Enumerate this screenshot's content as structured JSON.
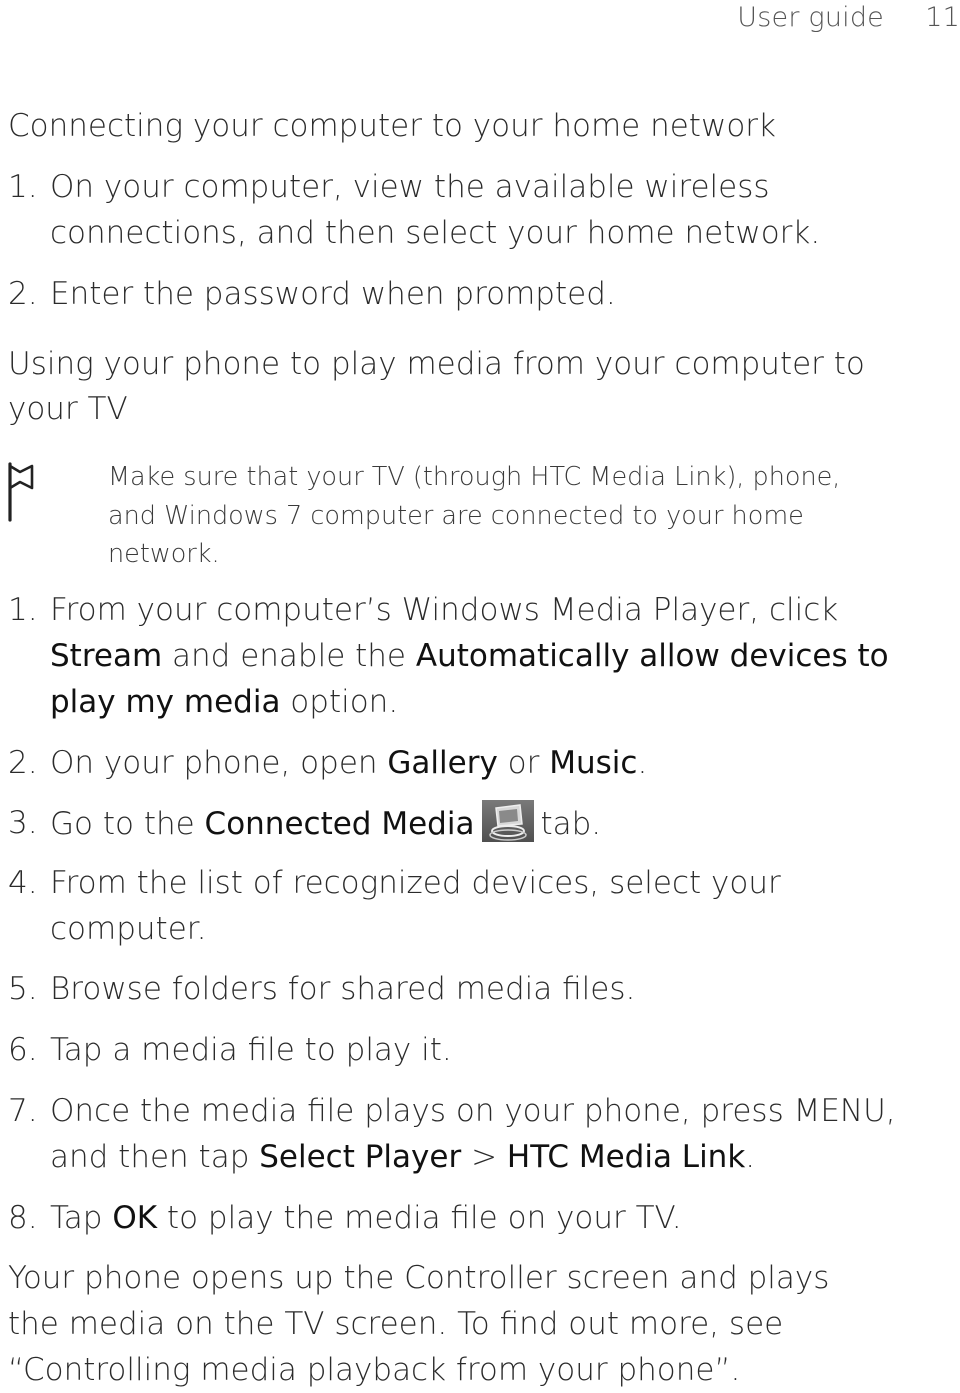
{
  "header": {
    "title": "User guide",
    "page_number": "11"
  },
  "section1": {
    "heading": "Connecting your computer to your home network",
    "steps": [
      {
        "n": "1.",
        "lines": [
          "On your computer, view the available wireless",
          "connections, and then select your home network."
        ]
      },
      {
        "n": "2.",
        "lines": [
          "Enter the password when prompted."
        ]
      }
    ]
  },
  "section2": {
    "heading_lines": [
      "Using your phone to play media from your computer to",
      "your TV"
    ],
    "note": {
      "icon": "flag-icon",
      "lines": [
        "Make sure that your TV (through HTC Media Link), phone,",
        "and Windows 7 computer are connected to your home",
        "network."
      ]
    },
    "steps": {
      "s1": {
        "n": "1.",
        "a": "From your computer’s Windows Media Player, click",
        "b_bold": "Stream",
        "b": " and enable the ",
        "b_bold2": "Automatically allow devices to",
        "c_bold": "play my media",
        "c": " option."
      },
      "s2": {
        "n": "2.",
        "a": "On your phone, open ",
        "bold1": "Gallery",
        "mid": " or ",
        "bold2": "Music",
        "end": "."
      },
      "s3": {
        "n": "3.",
        "a": "Go to the ",
        "bold": "Connected Media",
        "icon": "connected-media-icon",
        "end": "tab."
      },
      "s4": {
        "n": "4.",
        "lines": [
          "From the list of recognized devices, select your",
          "computer."
        ]
      },
      "s5": {
        "n": "5.",
        "text": "Browse folders for shared media files."
      },
      "s6": {
        "n": "6.",
        "text": "Tap a media file to play it."
      },
      "s7": {
        "n": "7.",
        "a": "Once the media file plays on your phone, press MENU,",
        "b": "and then tap ",
        "bold1": "Select Player",
        "sep": " > ",
        "bold2": "HTC Media Link",
        "end": "."
      },
      "s8": {
        "n": "8.",
        "a": "Tap ",
        "bold": "OK",
        "end": " to play the media file on your TV."
      }
    },
    "closing_lines": [
      "Your phone opens up the Controller screen and plays",
      "the media on the TV screen. To find out more, see",
      "“Controlling media playback from your phone”."
    ]
  }
}
